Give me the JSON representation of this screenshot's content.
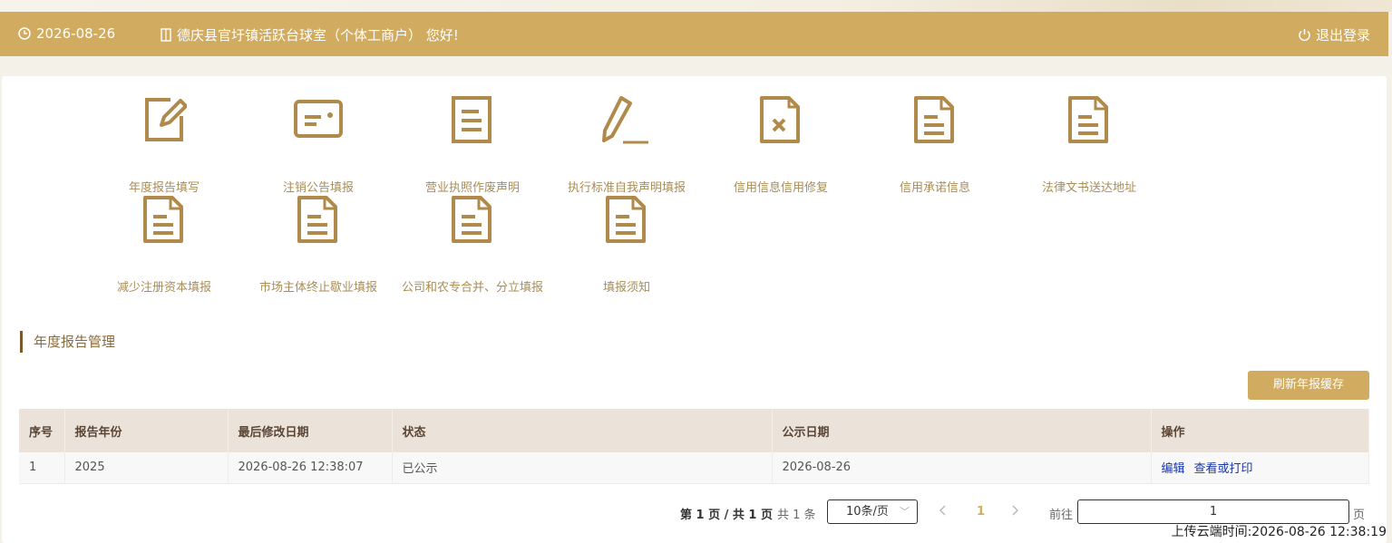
{
  "header": {
    "date": "2026-08-26",
    "greeting": "德庆县官圩镇活跃台球室（个体工商户） 您好!",
    "logout": "退出登录"
  },
  "tiles": [
    {
      "label": "年度报告填写",
      "icon": "edit-icon"
    },
    {
      "label": "注销公告填报",
      "icon": "id-card-icon"
    },
    {
      "label": "营业执照作废声明",
      "icon": "document-icon"
    },
    {
      "label": "执行标准自我声明填报",
      "icon": "pencil-icon"
    },
    {
      "label": "信用信息信用修复",
      "icon": "document-x-icon"
    },
    {
      "label": "信用承诺信息",
      "icon": "document-icon"
    },
    {
      "label": "法律文书送达地址",
      "icon": "document-icon"
    },
    {
      "label": "减少注册资本填报",
      "icon": "document-icon"
    },
    {
      "label": "市场主体终止歇业填报",
      "icon": "document-icon"
    },
    {
      "label": "公司和农专合并、分立填报",
      "icon": "document-icon"
    },
    {
      "label": "填报须知",
      "icon": "document-icon"
    }
  ],
  "section": {
    "title": "年度报告管理",
    "refresh_button": "刷新年报缓存"
  },
  "table": {
    "headers": [
      "序号",
      "报告年份",
      "最后修改日期",
      "状态",
      "公示日期",
      "操作"
    ],
    "rows": [
      {
        "index": "1",
        "year": "2025",
        "modified": "2026-08-26 12:38:07",
        "status": "已公示",
        "publish_date": "2026-08-26",
        "actions": [
          "编辑",
          "查看或打印"
        ]
      }
    ]
  },
  "pagination": {
    "page_info": "第 1 页 / 共 1 页",
    "total": "共 1 条",
    "page_size": "10条/页",
    "current_page": "1",
    "goto_label": "前往",
    "goto_value": "1",
    "page_unit": "页"
  },
  "upload_time": "上传云端时间:2026-08-26 12:38:19",
  "colors": {
    "header_bg": "#d0ab60",
    "icon_gold": "#b08a4a",
    "tile_text": "#a98d55",
    "link_blue": "#1a37a6"
  }
}
